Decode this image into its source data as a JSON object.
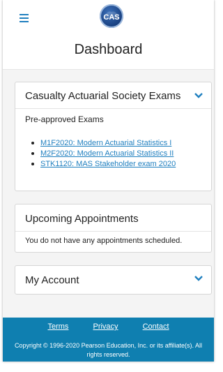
{
  "header": {
    "menu_icon": "hamburger-icon",
    "logo_text": "CAS",
    "logo_color": "#173e7d"
  },
  "page": {
    "title": "Dashboard"
  },
  "exams_card": {
    "title": "Casualty Actuarial Society Exams",
    "subtitle": "Pre-approved Exams",
    "exams": [
      "M1F2020: Modern Actuarial Statistics I",
      "M2F2020: Modern Actuarial Statistics II",
      "STK1120: MAS Stakeholder exam 2020"
    ],
    "toggle_icon": "chevron-down-icon"
  },
  "appointments_card": {
    "title": "Upcoming Appointments",
    "message": "You do not have any appointments scheduled."
  },
  "account_card": {
    "title": "My Account",
    "toggle_icon": "chevron-down-icon"
  },
  "footer": {
    "links": [
      "Terms",
      "Privacy",
      "Contact"
    ],
    "copyright": "Copyright © 1996-2020 Pearson Education, Inc. or its affiliate(s). All rights reserved.",
    "background": "#0f7fb0"
  },
  "colors": {
    "accent": "#1f7fbf"
  }
}
